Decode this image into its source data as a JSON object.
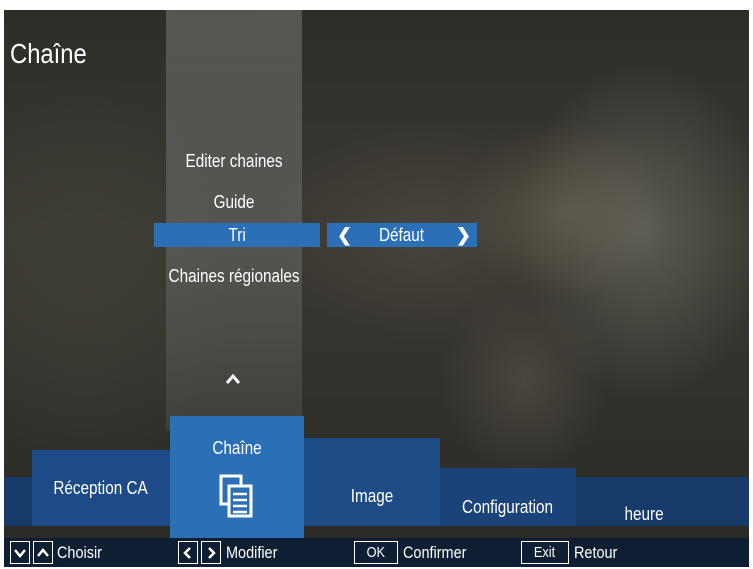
{
  "title": "Chaîne",
  "menu": {
    "items": [
      {
        "label": "Editer chaines"
      },
      {
        "label": "Guide"
      },
      {
        "label": "Tri"
      },
      {
        "label": "Chaines régionales"
      }
    ],
    "selected_value": "Défaut"
  },
  "tabs": [
    {
      "label": "Réception CA"
    },
    {
      "label": "Chaîne",
      "icon": "channel-list-icon",
      "active": true
    },
    {
      "label": "Image"
    },
    {
      "label": "Configuration"
    },
    {
      "label": "heure"
    }
  ],
  "help": {
    "choose": "Choisir",
    "modify": "Modifier",
    "ok_key": "OK",
    "confirm": "Confirmer",
    "exit_key": "Exit",
    "back": "Retour"
  },
  "colors": {
    "highlight": "#2b6fb7",
    "nav_bar": "#163a6a",
    "help_bar": "#0e1e33"
  }
}
